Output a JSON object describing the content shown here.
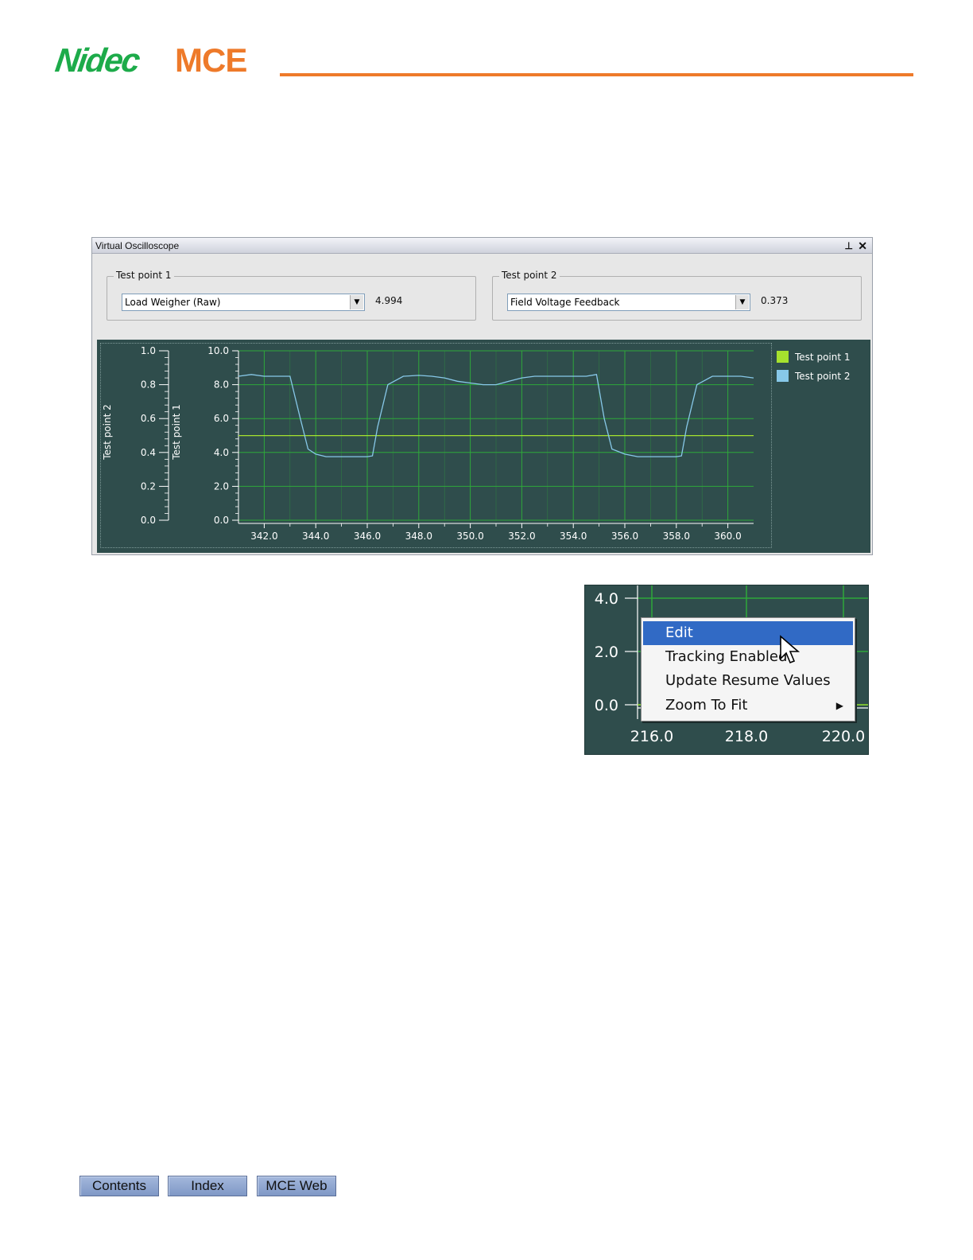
{
  "header": {
    "brand_left": "Nidec",
    "brand_right": "MCE",
    "brand_left_color": "#1dab4a",
    "brand_right_color": "#ee7a2a"
  },
  "window": {
    "title": "Virtual Oscilloscope",
    "pin_icon": "pin-icon",
    "close_icon": "close-icon",
    "test_point_1": {
      "label": "Test point 1",
      "selected": "Load Weigher (Raw)",
      "value": "4.994"
    },
    "test_point_2": {
      "label": "Test point 2",
      "selected": "Field Voltage Feedback",
      "value": "0.373"
    }
  },
  "chart_data": {
    "type": "line",
    "background": "#2f4d4c",
    "grid": true,
    "grid_color": "#2fa83a",
    "legend_placement": "right",
    "x": [
      341.0,
      341.5,
      342.0,
      342.5,
      343.0,
      343.4,
      343.7,
      344.0,
      344.4,
      345.0,
      345.5,
      346.0,
      346.2,
      346.4,
      346.8,
      347.4,
      348.0,
      348.5,
      349.0,
      349.5,
      350.0,
      350.5,
      351.0,
      351.5,
      352.0,
      352.5,
      353.0,
      353.5,
      354.0,
      354.5,
      354.9,
      355.2,
      355.5,
      356.0,
      356.5,
      357.0,
      357.5,
      358.0,
      358.2,
      358.4,
      358.8,
      359.4,
      360.0,
      360.5,
      361.0
    ],
    "series": [
      {
        "name": "Test point 1",
        "axis": "right",
        "color": "#a6e22e",
        "values": [
          4.994,
          4.994,
          4.994,
          4.994,
          4.994,
          4.994,
          4.994,
          4.994,
          4.994,
          4.994,
          4.994,
          4.994,
          4.994,
          4.994,
          4.994,
          4.994,
          4.994,
          4.994,
          4.994,
          4.994,
          4.994,
          4.994,
          4.994,
          4.994,
          4.994,
          4.994,
          4.994,
          4.994,
          4.994,
          4.994,
          4.994,
          4.994,
          4.994,
          4.994,
          4.994,
          4.994,
          4.994,
          4.994,
          4.994,
          4.994,
          4.994,
          4.994,
          4.994,
          4.994,
          4.994
        ]
      },
      {
        "name": "Test point 2",
        "axis": "left",
        "color": "#87c8e8",
        "values": [
          0.85,
          0.86,
          0.85,
          0.85,
          0.85,
          0.6,
          0.42,
          0.39,
          0.375,
          0.375,
          0.375,
          0.375,
          0.38,
          0.55,
          0.8,
          0.85,
          0.855,
          0.85,
          0.84,
          0.82,
          0.81,
          0.8,
          0.8,
          0.82,
          0.84,
          0.85,
          0.85,
          0.85,
          0.85,
          0.85,
          0.86,
          0.6,
          0.42,
          0.39,
          0.375,
          0.375,
          0.375,
          0.375,
          0.38,
          0.55,
          0.8,
          0.85,
          0.85,
          0.85,
          0.84
        ]
      }
    ],
    "x_ticks": [
      "342.0",
      "344.0",
      "346.0",
      "348.0",
      "350.0",
      "352.0",
      "354.0",
      "356.0",
      "358.0",
      "360.0"
    ],
    "x_tick_values": [
      342,
      344,
      346,
      348,
      350,
      352,
      354,
      356,
      358,
      360
    ],
    "xlim": [
      341.0,
      361.0
    ],
    "left_axis": {
      "label": "Test point 2",
      "ylim": [
        0.0,
        1.0
      ],
      "ticks": [
        "0.0",
        "0.2",
        "0.4",
        "0.6",
        "0.8",
        "1.0"
      ]
    },
    "right_axis": {
      "label": "Test point 1",
      "ylim": [
        0.0,
        10.0
      ],
      "ticks": [
        "0.0",
        "2.0",
        "4.0",
        "6.0",
        "8.0",
        "10.0"
      ]
    },
    "legend": [
      "Test point 1",
      "Test point 2"
    ]
  },
  "inset": {
    "y_ticks": [
      "4.0",
      "2.0",
      "0.0"
    ],
    "x_ticks": [
      "216.0",
      "218.0",
      "220.0"
    ],
    "menu": [
      {
        "label": "Edit",
        "highlighted": true
      },
      {
        "label": "Tracking Enabled",
        "highlighted": false
      },
      {
        "label": "Update Resume Values",
        "highlighted": false
      },
      {
        "label": "Zoom To Fit",
        "highlighted": false,
        "submenu": true
      }
    ],
    "cursor_icon": "mouse-pointer-icon",
    "submenu_icon": "triangle-right-icon"
  },
  "footer": {
    "buttons": [
      "Contents",
      "Index",
      "MCE Web"
    ]
  }
}
